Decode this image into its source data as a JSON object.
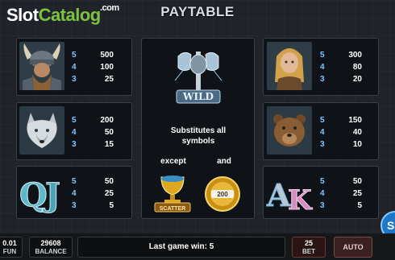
{
  "logo": {
    "part1": "Slot",
    "part2": "Catalog",
    "suffix": ".com"
  },
  "title": "PAYTABLE",
  "symbols": {
    "viking": {
      "icon": "viking-warrior-icon",
      "pays": [
        {
          "count": "5",
          "amount": "500"
        },
        {
          "count": "4",
          "amount": "100"
        },
        {
          "count": "3",
          "amount": "25"
        }
      ]
    },
    "wolf": {
      "icon": "wolf-icon",
      "pays": [
        {
          "count": "5",
          "amount": "200"
        },
        {
          "count": "4",
          "amount": "50"
        },
        {
          "count": "3",
          "amount": "15"
        }
      ]
    },
    "qj": {
      "icon": "letters-qj-icon",
      "letters": "QJ",
      "pays": [
        {
          "count": "5",
          "amount": "50"
        },
        {
          "count": "4",
          "amount": "25"
        },
        {
          "count": "3",
          "amount": "5"
        }
      ]
    },
    "maiden": {
      "icon": "shieldmaiden-icon",
      "pays": [
        {
          "count": "5",
          "amount": "300"
        },
        {
          "count": "4",
          "amount": "80"
        },
        {
          "count": "3",
          "amount": "20"
        }
      ]
    },
    "bear": {
      "icon": "bear-icon",
      "pays": [
        {
          "count": "5",
          "amount": "150"
        },
        {
          "count": "4",
          "amount": "40"
        },
        {
          "count": "3",
          "amount": "10"
        }
      ]
    },
    "ak": {
      "icon": "letters-ak-icon",
      "letters": "AK",
      "pays": [
        {
          "count": "5",
          "amount": "50"
        },
        {
          "count": "4",
          "amount": "25"
        },
        {
          "count": "3",
          "amount": "5"
        }
      ]
    }
  },
  "wild": {
    "icon": "wild-axe-icon",
    "label": "WILD",
    "description": "Substitutes all symbols",
    "except": "except",
    "and": "and",
    "scatter_icon": "scatter-chalice-icon",
    "scatter_label": "SCATTER",
    "coin_icon": "bonus-coin-icon",
    "coin_value": "200"
  },
  "bottom_bar": {
    "fun_value": "0.01",
    "fun_label": "FUN",
    "balance_value": "29608",
    "balance_label": "BALANCE",
    "last_win_text": "Last game win: 5",
    "bet_value": "25",
    "bet_label": "BET",
    "auto_label": "AUTO"
  },
  "colors": {
    "accent": "#7cc7ff",
    "logo_green": "#7dc242",
    "panel_bg": "#0f1216"
  }
}
